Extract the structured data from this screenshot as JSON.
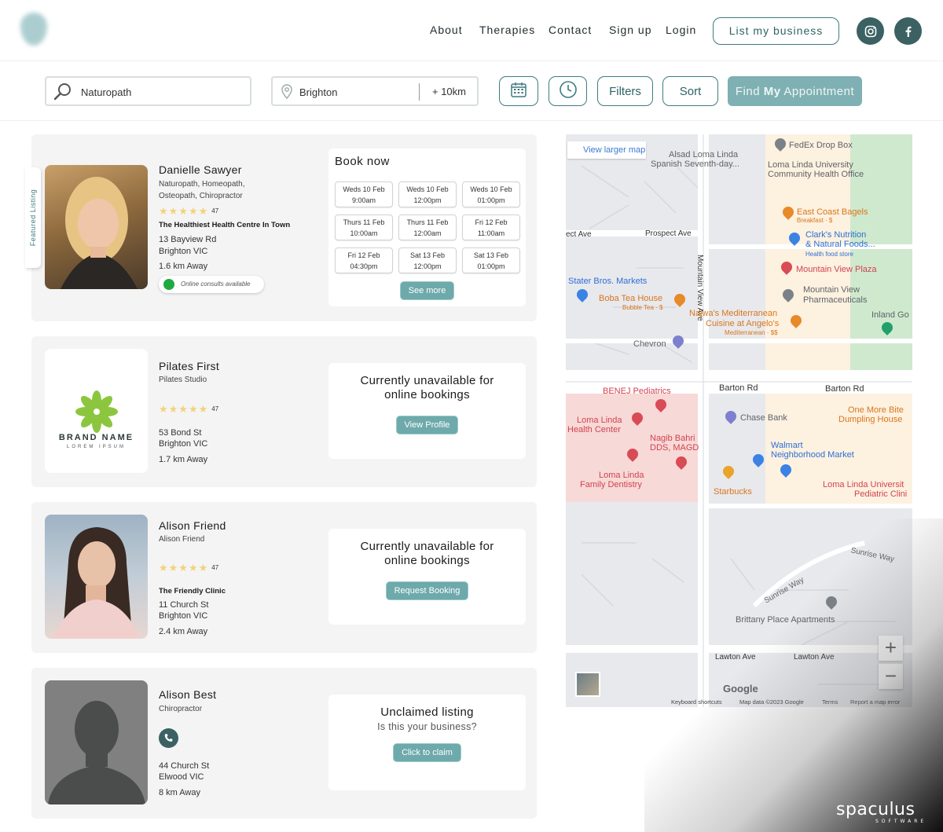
{
  "header": {
    "nav": [
      "About",
      "Therapies",
      "Contact",
      "Sign up",
      "Login"
    ],
    "list_business": "List my business",
    "social_icons": [
      "instagram-icon",
      "facebook-icon"
    ]
  },
  "search": {
    "therapy_value": "Naturopath",
    "location_value": "Brighton",
    "radius": "+ 10km",
    "filters_label": "Filters",
    "sort_label": "Sort",
    "find_prefix": "Find ",
    "find_bold": "My",
    "find_suffix": " Appointment"
  },
  "listings": [
    {
      "featured_label": "Featured Listing",
      "name": "Danielle Sawyer",
      "specialties_line1": "Naturopath, Homeopath,",
      "specialties_line2": "Osteopath, Chiropractor",
      "rating_count": "47",
      "clinic": "The Healthiest Health Centre In Town",
      "address_line1": "13 Bayview Rd",
      "address_line2": "Brighton VIC",
      "distance": "1.6 km Away",
      "online_badge": "Online consults available",
      "book_title": "Book now",
      "slots": [
        {
          "day": "Weds 10 Feb",
          "time": "9:00am"
        },
        {
          "day": "Weds 10 Feb",
          "time": "12:00pm"
        },
        {
          "day": "Weds 10 Feb",
          "time": "01:00pm"
        },
        {
          "day": "Thurs 11 Feb",
          "time": "10:00am"
        },
        {
          "day": "Thurs 11 Feb",
          "time": "12:00am"
        },
        {
          "day": "Fri 12 Feb",
          "time": "11:00am"
        },
        {
          "day": "Fri 12 Feb",
          "time": "04:30pm"
        },
        {
          "day": "Sat 13 Feb",
          "time": "12:00pm"
        },
        {
          "day": "Sat 13 Feb",
          "time": "01:00pm"
        }
      ],
      "see_more": "See more"
    },
    {
      "name": "Pilates First",
      "specialty": "Pilates Studio",
      "logo_text": "BRAND NAME",
      "logo_sub": "LOREM IPSUM",
      "rating_count": "47",
      "address_line1": "53 Bond St",
      "address_line2": "Brighton VIC",
      "distance": "1.7 km Away",
      "status_line1": "Currently unavailable for",
      "status_line2": "online bookings",
      "action": "View Profile"
    },
    {
      "name": "Alison Friend",
      "specialty": "Alison Friend",
      "rating_count": "47",
      "clinic": "The Friendly Clinic",
      "address_line1": "11 Church St",
      "address_line2": "Brighton VIC",
      "distance": "2.4 km Away",
      "status_line1": "Currently unavailable for",
      "status_line2": "online bookings",
      "action": "Request Booking"
    },
    {
      "name": "Alison Best",
      "specialty": "Chiropractor",
      "address_line1": "44 Church St",
      "address_line2": "Elwood VIC",
      "distance": "8 km Away",
      "status_title": "Unclaimed listing",
      "status_sub": "Is this your business?",
      "action": "Click to claim"
    }
  ],
  "map": {
    "view_larger": "View larger map",
    "labels": {
      "alsad": "Alsad Loma Linda",
      "spanish": "Spanish Seventh-day...",
      "fedex": "FedEx Drop Box",
      "llu_health1": "Loma Linda University",
      "llu_health2": "Community Health Office",
      "east_coast": "East Coast Bagels",
      "east_coast_sub": "Breakfast · $",
      "clarks1": "Clark's Nutrition",
      "clarks2": "& Natural Foods...",
      "clarks_sub": "Health food store",
      "mv_plaza": "Mountain View Plaza",
      "mv_pharm1": "Mountain View",
      "mv_pharm2": "Pharmaceuticals",
      "ect_ave": "ect Ave",
      "prospect": "Prospect Ave",
      "mv_ave": "Mountain View Ave",
      "stater": "Stater Bros. Markets",
      "boba": "Boba Tea House",
      "boba_sub": "Bubble Tea · $",
      "najwa1": "Najwa's Mediterranean",
      "najwa2": "Cuisine at Angelo's",
      "najwa_sub": "Mediterranean · $$",
      "inland": "Inland Go",
      "chevron": "Chevron",
      "barton": "Barton Rd",
      "benej": "BENEJ Pediatrics",
      "llhc1": "Loma Linda",
      "llhc2": "Health Center",
      "chase": "Chase Bank",
      "one_more1": "One More Bite",
      "one_more2": "Dumpling House",
      "nagib1": "Nagib Bahri",
      "nagib2": "DDS, MAGD",
      "walmart1": "Walmart",
      "walmart2": "Neighborhood Market",
      "llfd1": "Loma Linda",
      "llfd2": "Family Dentistry",
      "starbucks": "Starbucks",
      "llu_ped1": "Loma Linda Universit",
      "llu_ped2": "Pediatric Clini",
      "sunrise": "Sunrise Way",
      "brittany": "Brittany Place Apartments",
      "lawton": "Lawton Ave",
      "google": "Google",
      "footer": [
        "Keyboard shortcuts",
        "Map data ©2023 Google",
        "Terms",
        "Report a map error"
      ]
    }
  },
  "watermark": {
    "brand": "spaculus",
    "sub": "SOFTWARE"
  },
  "colors": {
    "accent": "#3d7c80",
    "pill": "#6ea9ab",
    "star": "#f3d27a",
    "online": "#1faa3f"
  }
}
